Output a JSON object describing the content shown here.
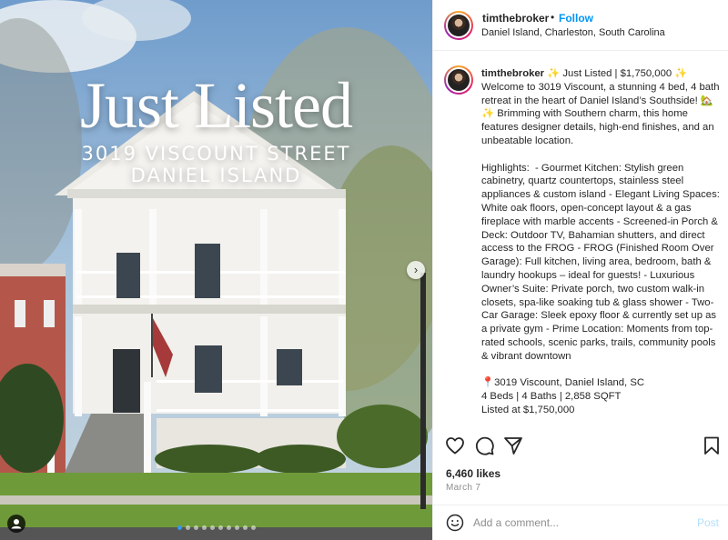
{
  "media": {
    "title": "Just Listed",
    "address_line1": "3019 VISCOUNT STREET",
    "address_line2": "DANIEL ISLAND",
    "next_icon": "chevron-right-icon",
    "carousel_count": 10,
    "carousel_active": 1,
    "sky_color": "#8fb0d6",
    "house_color": "#f2f2ee"
  },
  "header": {
    "username": "timthebroker",
    "separator": "•",
    "follow_label": "Follow",
    "location": "Daniel Island, Charleston, South Carolina"
  },
  "caption": {
    "username": "timthebroker",
    "text": " ✨ Just Listed | $1,750,000 ✨\nWelcome to 3019 Viscount, a stunning 4 bed, 4 bath retreat in the heart of Daniel Island’s Southside! 🏡✨ Brimming with Southern charm, this home features designer details, high-end finishes, and an unbeatable location.\n\nHighlights:  - Gourmet Kitchen: Stylish green cabinetry, quartz countertops, stainless steel appliances & custom island - Elegant Living Spaces: White oak floors, open-concept layout & a gas fireplace with marble accents - Screened-in Porch & Deck: Outdoor TV, Bahamian shutters, and direct access to the FROG - FROG (Finished Room Over Garage): Full kitchen, living area, bedroom, bath & laundry hookups – ideal for guests! - Luxurious Owner’s Suite: Private porch, two custom walk-in closets, spa-like soaking tub & glass shower - Two-Car Garage: Sleek epoxy floor & currently set up as a private gym - Prime Location: Moments from top-rated schools, scenic parks, trails, community pools & vibrant downtown\n\n📍3019 Viscount, Daniel Island, SC\n4 Beds | 4 Baths | 2,858 SQFT\nListed at $1,750,000"
  },
  "actions": {
    "like_icon": "heart-icon",
    "comment_icon": "comment-icon",
    "share_icon": "share-icon",
    "save_icon": "bookmark-icon"
  },
  "likes": "6,460 likes",
  "date": "March 7",
  "comment": {
    "placeholder": "Add a comment...",
    "post_label": "Post",
    "emoji_icon": "smiley-icon"
  },
  "colors": {
    "accent": "#0095f6",
    "post_disabled": "#b2dffc",
    "text": "#262626",
    "muted": "#8e8e8e"
  }
}
